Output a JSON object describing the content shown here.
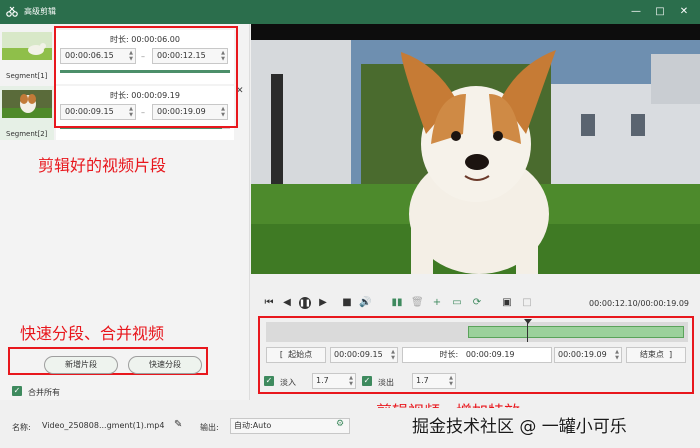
{
  "window": {
    "title": "高级剪辑",
    "controls": [
      "minimize",
      "maximize",
      "close"
    ]
  },
  "segments": [
    {
      "label": "Segment[1]",
      "duration_label": "时长:",
      "duration": "00:00:06.00",
      "start": "00:00:06.15",
      "end": "00:00:12.15",
      "progress": 1.0
    },
    {
      "label": "Segment[2]",
      "duration_label": "时长:",
      "duration": "00:00:09.19",
      "start": "00:00:09.15",
      "end": "00:00:19.09",
      "progress": 0.95
    }
  ],
  "annotations": {
    "clips": "剪辑好的视频片段",
    "split_merge": "快速分段、合并视频",
    "edit_effects": "剪辑视频，增加特效"
  },
  "left_buttons": {
    "add_segment": "新增片段",
    "quick_split": "快速分段"
  },
  "merge_all": {
    "label": "合并所有",
    "checked": true
  },
  "player": {
    "time_display": "00:00:12.10/00:00:19.09",
    "controls": [
      "skip-start-icon",
      "step-back-icon",
      "pause-icon",
      "step-forward-icon",
      "stop-icon",
      "volume-icon",
      "split-icon",
      "delete-icon",
      "add-icon",
      "copy-icon",
      "reset-icon",
      "crop-icon",
      "fit-icon"
    ]
  },
  "editor": {
    "start_button": "起始点",
    "start_time": "00:00:09.15",
    "duration_label": "时长:",
    "duration": "00:00:09.19",
    "end_time": "00:00:19.09",
    "end_button": "结束点",
    "fade_in": {
      "label": "淡入",
      "value": "1.7",
      "checked": true
    },
    "fade_out": {
      "label": "淡出",
      "value": "1.7",
      "checked": true
    },
    "selection": {
      "start_fraction": 0.48,
      "end_fraction": 0.99,
      "playhead_fraction": 0.62
    }
  },
  "bottom": {
    "name_label": "名称:",
    "name_value": "Video_250808...gment(1).mp4",
    "output_label": "输出:",
    "output_value": "自动:Auto",
    "watermark": "掘金技术社区 @ 一罐小可乐"
  },
  "colors": {
    "titlebar": "#2b6e4c",
    "annotation": "#e8171d",
    "accent": "#3e8a5e",
    "selection": "#9bd19b"
  }
}
